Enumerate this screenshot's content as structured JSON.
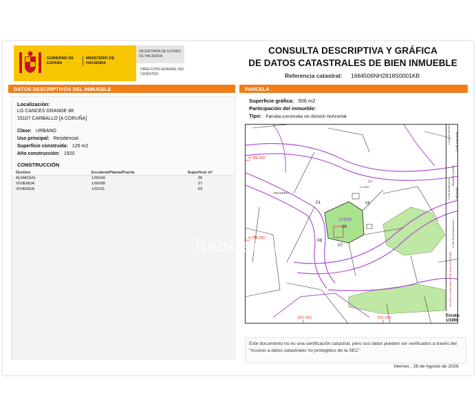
{
  "header": {
    "gobierno": "GOBIERNO DE ESPAÑA",
    "ministerio": "MINISTERIO DE HACIENDA",
    "secretaria": "SECRETARÍA DE ESTADO DE HACIENDA",
    "direccion": "DIRECCIÓN GENERAL DEL CATASTRO",
    "title_line1": "CONSULTA DESCRIPTIVA Y GRÁFICA",
    "title_line2": "DE DATOS CATASTRALES DE BIEN INMUEBLE",
    "ref_label": "Referencia catastral:",
    "ref_value": "1684506NH2818S0001KB"
  },
  "left": {
    "section_title": "DATOS DESCRIPTIVOS DEL INMUEBLE",
    "localizacion_label": "Localización:",
    "address_line1": "LG CANCES GRANDE 88",
    "address_line2": "15107 CARBALLO [A CORUÑA]",
    "clase_label": "Clase:",
    "clase_value": "URBANO",
    "uso_label": "Uso principal:",
    "uso_value": "Residencial",
    "superficie_label": "Superficie construida:",
    "superficie_value": "126 m2",
    "anio_label": "Año construcción:",
    "anio_value": "1920",
    "construccion_title": "CONSTRUCCIÓN",
    "table": {
      "headers": [
        "Destino",
        "Escalera/Planta/Puerta",
        "Superficie m²"
      ],
      "rows": [
        [
          "ALMACEN",
          "1/00/0A",
          "36"
        ],
        [
          "VIVIENDA",
          "1/00/0B",
          "27"
        ],
        [
          "VIVIENDA",
          "1/01/01",
          "63"
        ]
      ]
    }
  },
  "right": {
    "section_title": "PARCELA",
    "sup_grafica_label": "Superficie gráfica:",
    "sup_grafica_value": "506 m2",
    "participacion_label": "Participación del inmueble:",
    "tipo_label": "Tipo:",
    "tipo_value": "Parcela construida sin división horizontal",
    "map": {
      "coord_n1": "4.788.300",
      "coord_n2": "4.788.250",
      "coord_e1": "521.550",
      "coord_e2": "521.600",
      "parcel_number": "16845",
      "labels": [
        "01",
        "06",
        "05",
        "08",
        "07",
        "CRUCERO",
        "C3",
        "E-VIDA"
      ],
      "legend": [
        "Límite de Manzana",
        "Límite de Parcela",
        "Límite de Construcciones",
        "Mobiliario y aceras",
        "Límite zona verde",
        "Hidrografía"
      ],
      "coords_vertical": "521.600 Coordenadas U.T.M. Huso 29 ETRS89"
    },
    "escala_label": "Escala:",
    "escala_value": "1/1000",
    "note": "Este documento no es una certificación catastral, pero sus datos pueden ser verificados a través del \"Acceso a datos catastrales no protegidos de la SEC\"",
    "date": "Viernes , 28 de Agosto de 2026"
  },
  "watermark": "habitaclia",
  "colors": {
    "orange": "#f07d18",
    "yellow": "#f7c600",
    "parcel_green": "#a9e38d",
    "street_purple": "#b04fd0"
  }
}
